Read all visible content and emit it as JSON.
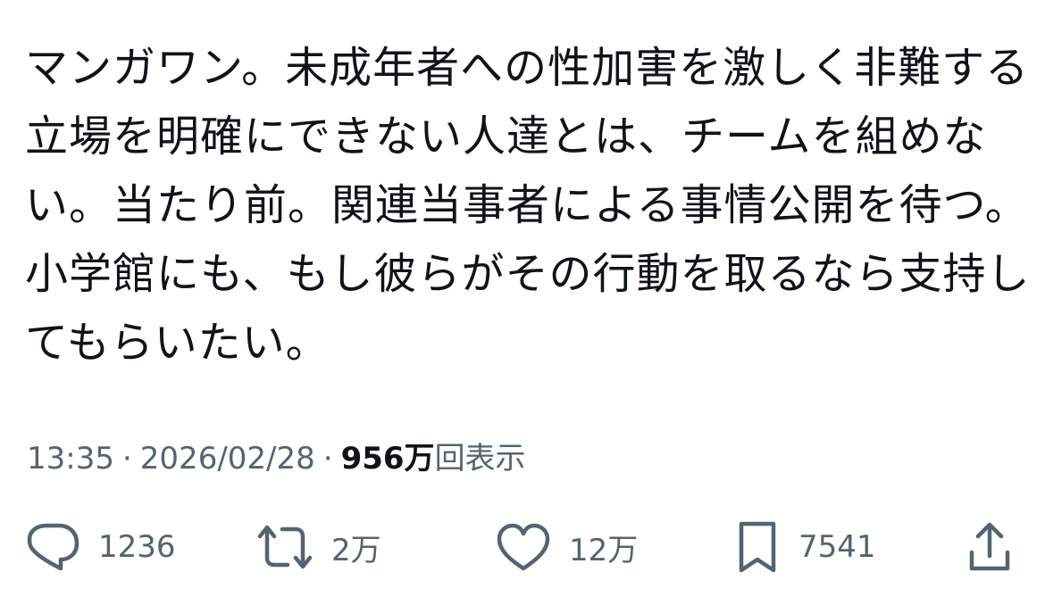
{
  "tweet": {
    "lines": [
      "マンガワン。未成年者への性加害を激しく非難する",
      "立場を明確にできない人達とは、チームを組めな",
      "い。当たり前。関連当事者による事情公開を待つ。",
      "小学館にも、もし彼らがその行動を取るなら支持し",
      "てもらいたい。"
    ]
  },
  "meta": {
    "time": "13:35",
    "separator": "·",
    "date": "2026/02/28",
    "views_count": "956万",
    "views_label": "回表示"
  },
  "actions": {
    "reply_count": "1236",
    "retweet_count": "2万",
    "like_count": "12万",
    "bookmark_count": "7541"
  },
  "colors": {
    "text": "#0f1419",
    "secondary": "#536471",
    "background": "#ffffff"
  },
  "icons": {
    "reply": "speech-bubble-icon",
    "retweet": "retweet-arrows-icon",
    "like": "heart-icon",
    "bookmark": "bookmark-icon",
    "share": "share-upload-icon"
  }
}
